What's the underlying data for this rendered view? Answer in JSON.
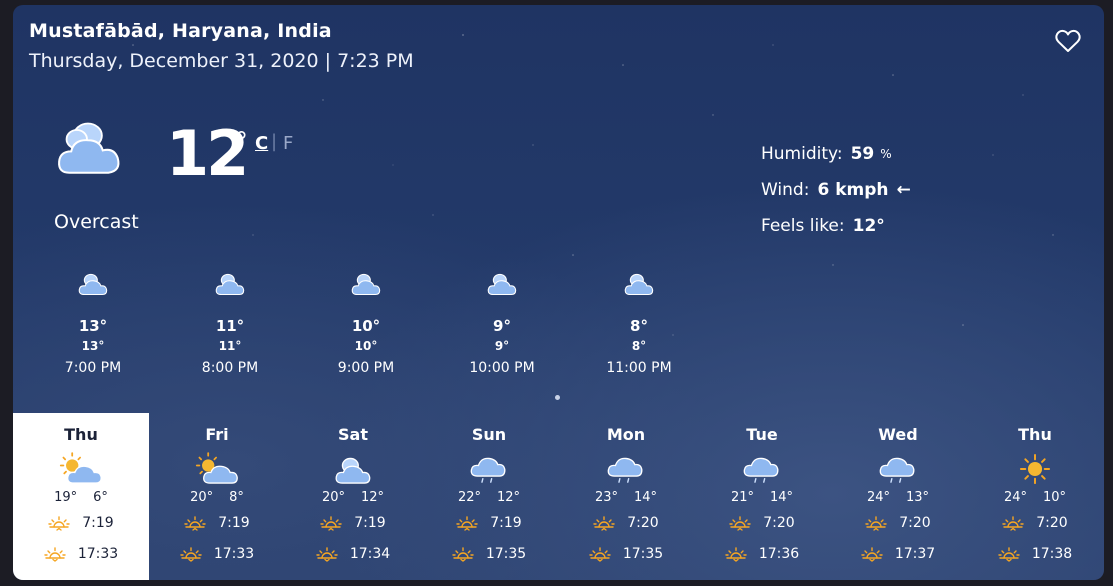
{
  "header": {
    "location": "Mustafābād, Haryana, India",
    "datetime": "Thursday, December 31, 2020 | 7:23 PM"
  },
  "current": {
    "temp": "12",
    "degree": "°",
    "unit_c": "C",
    "unit_sep": "|",
    "unit_f": "F",
    "condition": "Overcast",
    "icon": "overcast-cloud-icon"
  },
  "details": {
    "humidity_label": "Humidity:",
    "humidity_value": "59",
    "humidity_unit": "%",
    "wind_label": "Wind:",
    "wind_value": "6 kmph",
    "wind_arrow": "←",
    "feels_label": "Feels like:",
    "feels_value": "12°"
  },
  "hourly": [
    {
      "t1": "13°",
      "t2": "13°",
      "time": "7:00 PM"
    },
    {
      "t1": "11°",
      "t2": "11°",
      "time": "8:00 PM"
    },
    {
      "t1": "10°",
      "t2": "10°",
      "time": "9:00 PM"
    },
    {
      "t1": "9°",
      "t2": "9°",
      "time": "10:00 PM"
    },
    {
      "t1": "8°",
      "t2": "8°",
      "time": "11:00 PM"
    }
  ],
  "daily": [
    {
      "name": "Thu",
      "hi": "19°",
      "lo": "6°",
      "sunrise": "7:19",
      "sunset": "17:33",
      "icon": "partly-cloudy-icon"
    },
    {
      "name": "Fri",
      "hi": "20°",
      "lo": "8°",
      "sunrise": "7:19",
      "sunset": "17:33",
      "icon": "partly-cloudy-icon"
    },
    {
      "name": "Sat",
      "hi": "20°",
      "lo": "12°",
      "sunrise": "7:19",
      "sunset": "17:34",
      "icon": "cloudy-icon"
    },
    {
      "name": "Sun",
      "hi": "22°",
      "lo": "12°",
      "sunrise": "7:19",
      "sunset": "17:35",
      "icon": "light-rain-icon"
    },
    {
      "name": "Mon",
      "hi": "23°",
      "lo": "14°",
      "sunrise": "7:20",
      "sunset": "17:35",
      "icon": "light-rain-icon"
    },
    {
      "name": "Tue",
      "hi": "21°",
      "lo": "14°",
      "sunrise": "7:20",
      "sunset": "17:36",
      "icon": "light-rain-icon"
    },
    {
      "name": "Wed",
      "hi": "24°",
      "lo": "13°",
      "sunrise": "7:20",
      "sunset": "17:37",
      "icon": "light-rain-icon"
    },
    {
      "name": "Thu",
      "hi": "24°",
      "lo": "10°",
      "sunrise": "7:20",
      "sunset": "17:38",
      "icon": "sunny-icon"
    }
  ],
  "colors": {
    "background_top": "#1f3463",
    "background_bottom": "#2b416f",
    "cloud": "#8fb8f0",
    "sun": "#f5a623",
    "selected_bg": "#ffffff"
  }
}
